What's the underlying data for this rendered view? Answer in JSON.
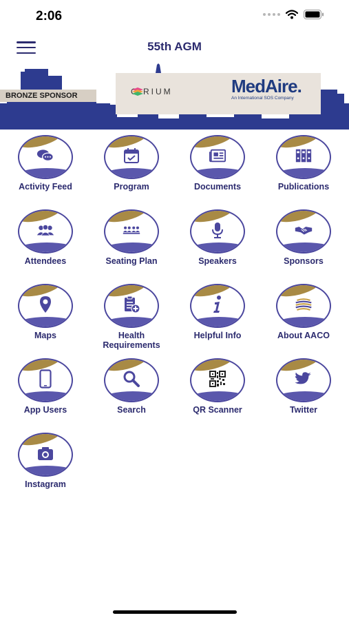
{
  "status_bar": {
    "time": "2:06"
  },
  "nav": {
    "title": "55th AGM"
  },
  "banner": {
    "sponsor_tag": "BRONZE SPONSOR",
    "cirium": "CIRIUM",
    "medaire_name": "MedAire.",
    "medaire_sub": "An International SOS Company"
  },
  "colors": {
    "primary": "#2b2a6e",
    "accent_purple": "#5a57ac",
    "accent_gold": "#a88a45",
    "skyline": "#2d3b8f"
  },
  "tiles": [
    {
      "label": "Activity Feed",
      "icon": "chat-bubbles-icon"
    },
    {
      "label": "Program",
      "icon": "calendar-icon"
    },
    {
      "label": "Documents",
      "icon": "newspaper-icon"
    },
    {
      "label": "Publications",
      "icon": "binders-icon"
    },
    {
      "label": "Attendees",
      "icon": "people-icon"
    },
    {
      "label": "Seating Plan",
      "icon": "seating-icon"
    },
    {
      "label": "Speakers",
      "icon": "microphone-icon"
    },
    {
      "label": "Sponsors",
      "icon": "handshake-icon"
    },
    {
      "label": "Maps",
      "icon": "map-pin-icon"
    },
    {
      "label": "Health Requirements",
      "icon": "clipboard-plus-icon"
    },
    {
      "label": "Helpful Info",
      "icon": "info-icon"
    },
    {
      "label": "About AACO",
      "icon": "aaco-logo-icon"
    },
    {
      "label": "App Users",
      "icon": "phone-icon"
    },
    {
      "label": "Search",
      "icon": "search-icon"
    },
    {
      "label": "QR Scanner",
      "icon": "qr-code-icon"
    },
    {
      "label": "Twitter",
      "icon": "twitter-bird-icon"
    },
    {
      "label": "Instagram",
      "icon": "camera-icon"
    }
  ]
}
